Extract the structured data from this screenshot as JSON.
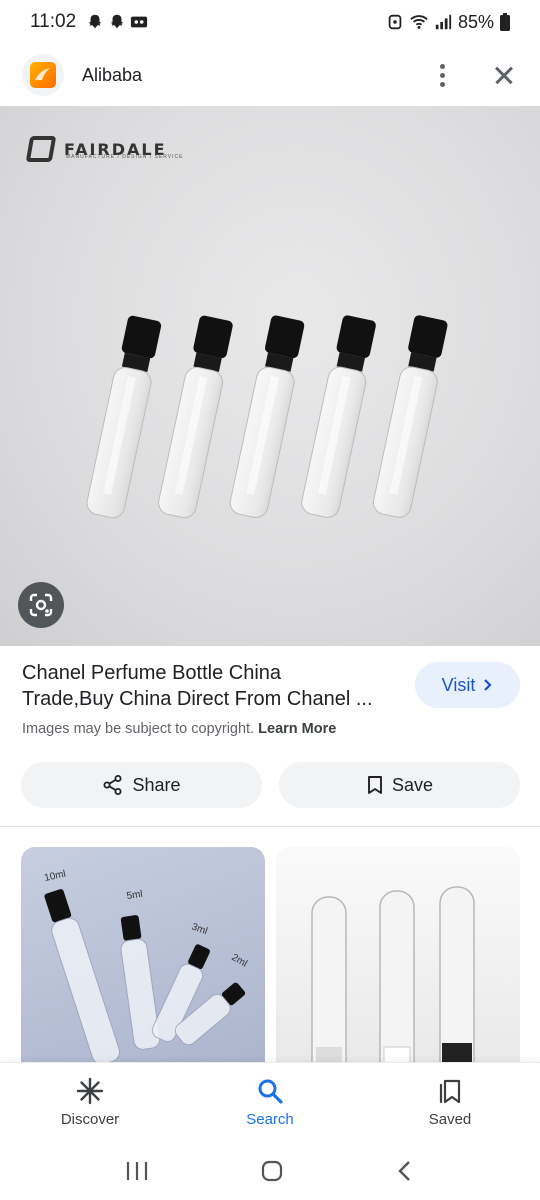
{
  "status_bar": {
    "time": "11:02",
    "battery": "85%"
  },
  "header": {
    "site_name": "Alibaba"
  },
  "hero": {
    "brand": "FAIRDALE",
    "brand_sub": "MANUFACTURE / DESIGN / SERVICE"
  },
  "result": {
    "title_line1": "Chanel Perfume Bottle China",
    "title_line2": "Trade,Buy China Direct From Chanel ...",
    "visit_label": "Visit",
    "copyright_text": "Images may be subject to copyright.",
    "learn_more": "Learn More"
  },
  "actions": {
    "share_label": "Share",
    "save_label": "Save"
  },
  "thumbs": {
    "labels": [
      "10ml",
      "5ml",
      "3ml",
      "2ml"
    ]
  },
  "bottom_nav": [
    {
      "label": "Discover",
      "icon": "asterisk-icon"
    },
    {
      "label": "Search",
      "icon": "search-icon"
    },
    {
      "label": "Saved",
      "icon": "bookmark-stack-icon"
    }
  ],
  "colors": {
    "accent": "#1a73e8",
    "visit_bg": "#e8f0fe",
    "chip_bg": "#f1f3f4"
  }
}
